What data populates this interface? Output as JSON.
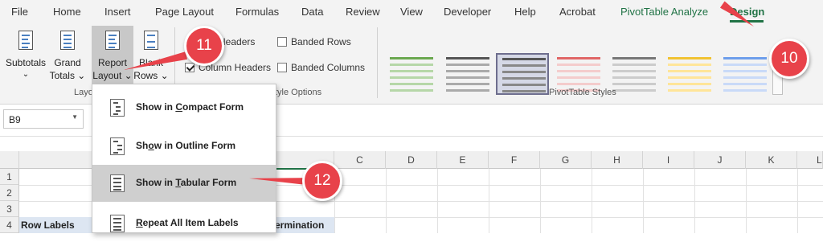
{
  "menu": {
    "tabs": [
      "File",
      "Home",
      "Insert",
      "Page Layout",
      "Formulas",
      "Data",
      "Review",
      "View",
      "Developer",
      "Help",
      "Acrobat",
      "PivotTable Analyze",
      "Design"
    ],
    "active": "Design",
    "accent": "#217346"
  },
  "ribbon": {
    "subtotals": [
      "Subtotals",
      "⌄"
    ],
    "grand_totals": [
      "Grand",
      "Totals ⌄"
    ],
    "report_layout": [
      "Report",
      "Layout ⌄"
    ],
    "blank_rows": [
      "Blank",
      "Rows ⌄"
    ],
    "layout_group": "Layo",
    "checkboxes": {
      "row_headers": "Headers",
      "column_headers": "Column Headers",
      "banded_rows": "Banded Rows",
      "banded_columns": "Banded Columns"
    },
    "style_options_group": "tyle Options",
    "styles_group": "PivotTable Styles"
  },
  "namebox": {
    "value": "B9"
  },
  "grid": {
    "columns": [
      "C",
      "D",
      "E",
      "F",
      "G",
      "H",
      "I",
      "J",
      "K",
      "L"
    ],
    "rows": [
      "1",
      "2",
      "3",
      "4"
    ],
    "a4": "Row Labels",
    "b4": "ermination"
  },
  "dropdown": {
    "items": [
      {
        "pre": "Show in ",
        "ul": "C",
        "post": "ompact Form"
      },
      {
        "pre": "Sh",
        "ul": "o",
        "post": "w in Outline Form"
      },
      {
        "pre": "Show in ",
        "ul": "T",
        "post": "abular Form"
      },
      {
        "pre": "",
        "ul": "R",
        "post": "epeat All Item Labels"
      }
    ],
    "highlighted_index": 2
  },
  "callouts": {
    "c10": "10",
    "c11": "11",
    "c12": "12",
    "color": "#e8424a"
  }
}
